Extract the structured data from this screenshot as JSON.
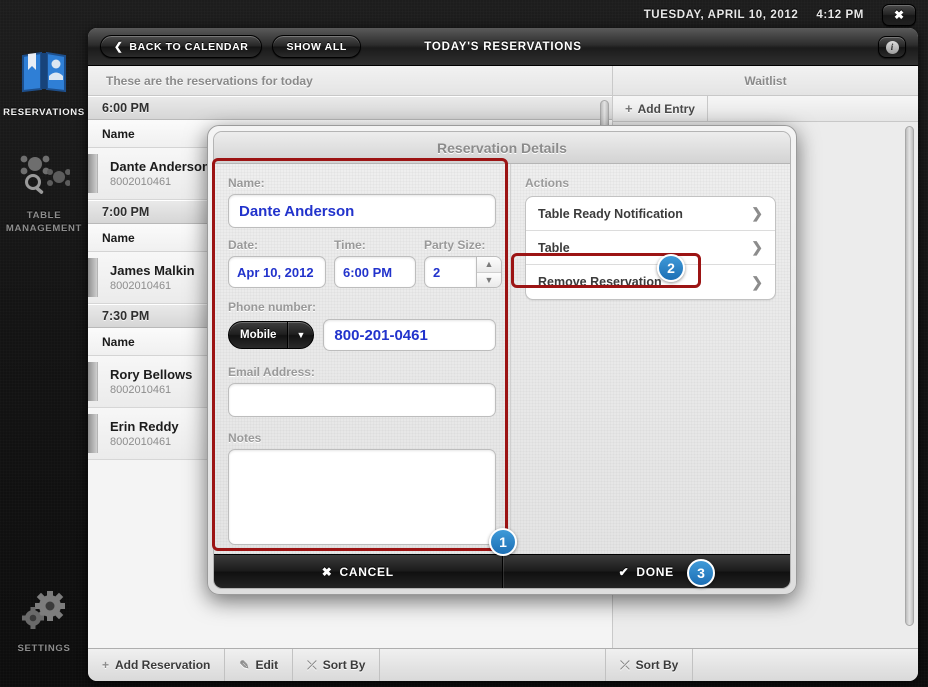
{
  "statusbar": {
    "date": "TUESDAY, APRIL 10, 2012",
    "time": "4:12 PM",
    "close_icon": "✖"
  },
  "rail": {
    "items": [
      {
        "label": "RESERVATIONS",
        "icon": "book-person-icon",
        "active": true
      },
      {
        "label": "TABLE MANAGEMENT",
        "icon": "tables-search-icon",
        "active": false
      },
      {
        "label": "SETTINGS",
        "icon": "gears-icon",
        "active": false
      }
    ]
  },
  "toolbar": {
    "back_label": "BACK TO CALENDAR",
    "back_icon": "❮",
    "show_all_label": "SHOW ALL",
    "title": "TODAY'S RESERVATIONS",
    "info_label": "i"
  },
  "left_panel": {
    "header": "These are the reservations for today",
    "groups": [
      {
        "time": "6:00 PM",
        "column_header": "Name",
        "rows": [
          {
            "name": "Dante Anderson",
            "phone": "8002010461"
          }
        ]
      },
      {
        "time": "7:00 PM",
        "column_header": "Name",
        "rows": [
          {
            "name": "James Malkin",
            "phone": "8002010461"
          }
        ]
      },
      {
        "time": "7:30 PM",
        "column_header": "Name",
        "rows": [
          {
            "name": "Rory Bellows",
            "phone": "8002010461"
          },
          {
            "name": "Erin Reddy",
            "phone": "8002010461"
          }
        ]
      }
    ]
  },
  "right_panel": {
    "header": "Waitlist",
    "add_entry_label": "Add Entry",
    "add_entry_icon": "+"
  },
  "footer": {
    "add_reservation_label": "Add Reservation",
    "add_reservation_icon": "+",
    "edit_label": "Edit",
    "edit_icon": "✎",
    "sort_by_label": "Sort By",
    "sort_by_icon": "⤫",
    "waitlist_sort_by_label": "Sort By"
  },
  "modal": {
    "title": "Reservation Details",
    "fields": {
      "name_label": "Name:",
      "name_value": "Dante Anderson",
      "date_label": "Date:",
      "date_value": "Apr 10, 2012",
      "time_label": "Time:",
      "time_value": "6:00 PM",
      "party_label": "Party Size:",
      "party_value": "2",
      "stepper_up": "▲",
      "stepper_down": "▼",
      "phone_label": "Phone number:",
      "phone_type": "Mobile",
      "phone_type_arrow": "▼",
      "phone_value": "800-201-0461",
      "email_label": "Email Address:",
      "email_value": "",
      "notes_label": "Notes",
      "notes_value": ""
    },
    "actions": {
      "title": "Actions",
      "items": [
        {
          "label": "Table Ready Notification",
          "chevron": "❯"
        },
        {
          "label": "Table",
          "chevron": "❯"
        },
        {
          "label": "Remove Reservation",
          "chevron": "❯"
        }
      ]
    },
    "footer": {
      "cancel_label": "CANCEL",
      "cancel_icon": "✖",
      "done_label": "DONE",
      "done_icon": "✔"
    }
  },
  "annotations": {
    "badges": [
      {
        "number": "1"
      },
      {
        "number": "2"
      },
      {
        "number": "3"
      }
    ],
    "highlight_color": "#9c1414",
    "badge_color": "#2a7fc4"
  }
}
